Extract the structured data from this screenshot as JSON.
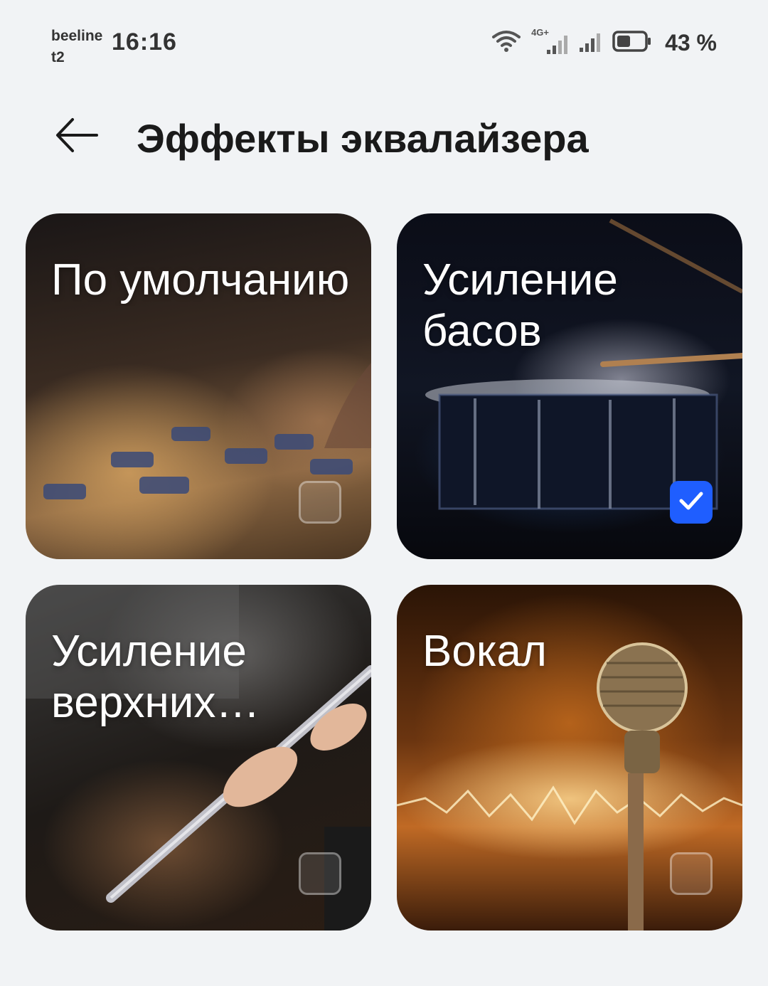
{
  "status_bar": {
    "carrier_line1": "beeline",
    "carrier_line2": "t2",
    "time": "16:16",
    "network_badge": "4G+",
    "battery_percent": "43 %",
    "battery_level": 0.43
  },
  "header": {
    "back_icon": "arrow-left-icon",
    "title": "Эффекты эквалайзера"
  },
  "effects": [
    {
      "label": "По умолчанию",
      "checked": false
    },
    {
      "label": "Усиление басов",
      "checked": true
    },
    {
      "label": "Усиление верхних частот",
      "checked": false
    },
    {
      "label": "Вокал",
      "checked": false
    }
  ],
  "colors": {
    "background": "#f1f3f5",
    "accent": "#1f5eff",
    "text": "#1a1a1a"
  }
}
